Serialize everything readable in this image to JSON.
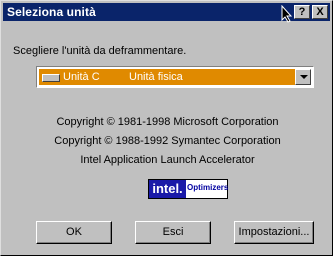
{
  "window": {
    "title": "Seleziona unità",
    "help_button": "?",
    "close_button": "X"
  },
  "dialog": {
    "prompt": "Scegliere l'unità da deframmentare.",
    "drive_select": {
      "selected_name": "Unità C",
      "selected_type": "Unità fisica"
    },
    "copyright_1": "Copyright © 1981-1998 Microsoft Corporation",
    "copyright_2": "Copyright © 1988-1992 Symantec Corporation",
    "product_line": "Intel Application Launch Accelerator",
    "logo": {
      "left_text": "intel.",
      "right_text": "Optimizers"
    }
  },
  "buttons": {
    "ok": "OK",
    "exit": "Esci",
    "settings": "Impostazioni..."
  }
}
